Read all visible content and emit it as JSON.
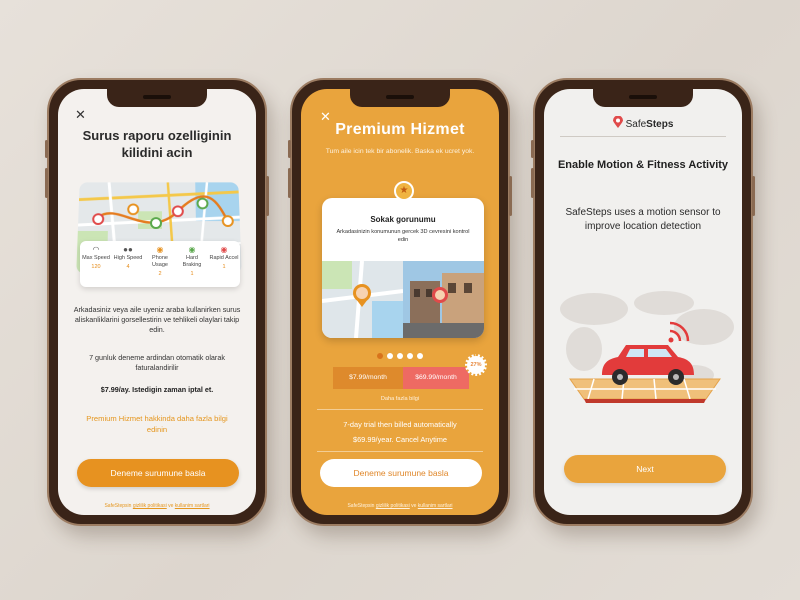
{
  "colors": {
    "accent_orange": "#e79220",
    "premium_bg": "#e9a43d",
    "frame_brown": "#3a2418",
    "link_orange": "#e5961e",
    "price_red": "#ee6a63"
  },
  "screen1": {
    "close_icon": "close-icon",
    "title": "Surus raporu ozelliginin kilidini acin",
    "stats": [
      {
        "icon": "speedometer-icon",
        "label": "Max Speed",
        "value": "120"
      },
      {
        "icon": "people-icon",
        "label": "High Speed",
        "value": "4"
      },
      {
        "icon": "phone-icon",
        "label": "Phone Usage",
        "value": "2"
      },
      {
        "icon": "brake-icon",
        "label": "Hard Braking",
        "value": "1"
      },
      {
        "icon": "accel-icon",
        "label": "Rapid Accel",
        "value": "1"
      }
    ],
    "description": "Arkadasiniz veya aile uyeniz araba kullanirken surus aliskanliklarini gorsellestirin ve tehlikeli olaylari takip edin.",
    "trial_text": "7 gunluk deneme ardindan otomatik olarak faturalandirilir",
    "price_text": "$7.99/ay. Istedigin zaman iptal et.",
    "more_link": "Premium Hizmet hakkinda daha fazla bilgi edinin",
    "cta": "Deneme surumune basla",
    "footer_prefix": "SafeStepsin",
    "footer_privacy": "gizlilik politikasi",
    "footer_and": "ve",
    "footer_terms": "kullanim sartlari"
  },
  "screen2": {
    "title": "Premium Hizmet",
    "subtitle": "Tum aile icin tek bir abonelik. Baska ek ucret yok.",
    "card_title": "Sokak gorunumu",
    "card_desc": "Arkadasinizin konumunun gercek 3D cevresini kontrol edin",
    "dots_count": 5,
    "active_dot": 0,
    "plan_monthly": "$7.99/month",
    "plan_yearly": "$69.99/month",
    "discount_badge": "27%",
    "more_info": "Daha fazla bilgi",
    "trial_line": "7-day trial then billed automatically",
    "price_line": "$69.99/year. Cancel Anytime",
    "cta": "Deneme surumune basla",
    "footer_prefix": "SafeStepsin",
    "footer_privacy": "gizlilik politikasi",
    "footer_and": "ve",
    "footer_terms": "kullanim sartlari"
  },
  "screen3": {
    "logo_prefix": "Safe",
    "logo_suffix": "Steps",
    "title": "Enable Motion & Fitness Activity",
    "description": "SafeSteps uses a motion sensor to improve location detection",
    "cta": "Next"
  }
}
